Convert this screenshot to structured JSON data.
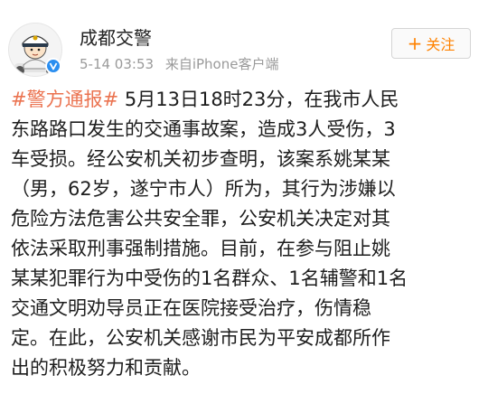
{
  "post": {
    "username": "成都交警",
    "timestamp": "5-14 03:53",
    "source": "来自iPhone客户端",
    "follow_label": "关注",
    "follow_symbol": "+",
    "hashtag": "#警方通报#",
    "lines": [
      " 5月13日18时23分，在我市人民",
      "东路路口发生的交通事故案，造成3人受伤，3",
      "车受损。经公安机关初步查明，该案系姚某某",
      "（男，62岁，遂宁市人）所为，其行为涉嫌以",
      "危险方法危害公共安全罪，公安机关决定对其",
      "依法采取刑事强制措施。目前，在参与阻止姚",
      "某某犯罪行为中受伤的1名群众、1名辅警和1名",
      "交通文明劝导员正在医院接受治疗，伤情稳",
      "定。在此，公安机关感谢市民为平安成都所作",
      "出的积极努力和贡献。"
    ]
  },
  "icons": {
    "avatar": "police-officer-cartoon-icon",
    "badge": "verified-v-icon"
  },
  "colors": {
    "accent": "#ff8200",
    "hashtag": "#eb7350",
    "verified": "#2a8ef0",
    "meta_text": "#9a9a9a"
  }
}
